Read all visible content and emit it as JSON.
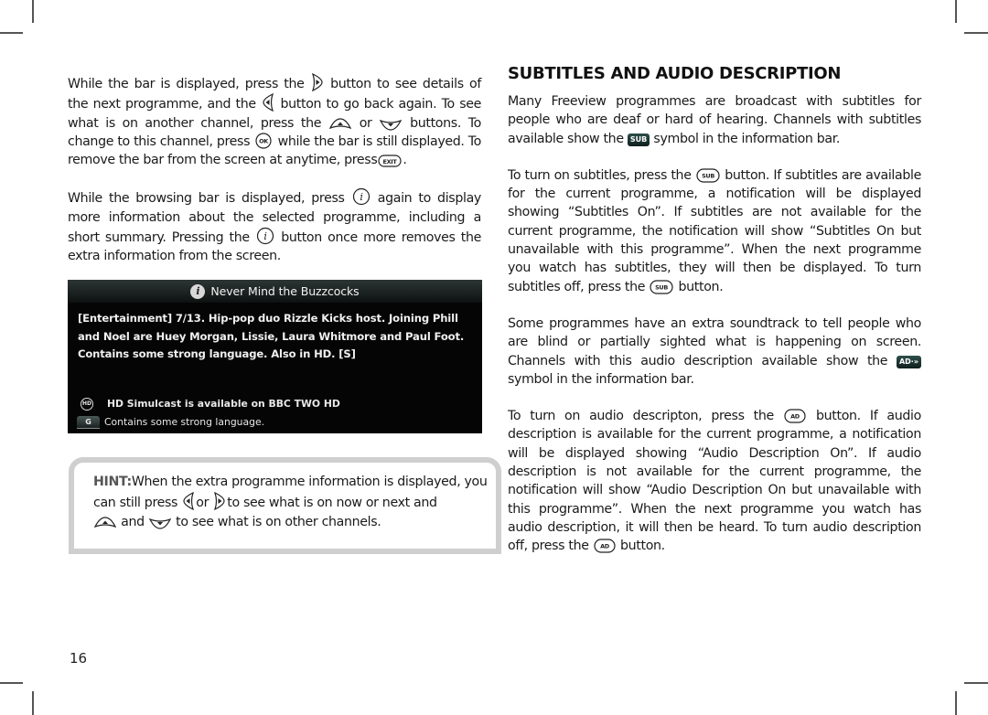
{
  "page": {
    "number": "16"
  },
  "left_column": {
    "para1": {
      "t1": "While the bar is displayed, press the",
      "t2": "button to see details of the next programme, and the",
      "t3": "button to go back again. To see what is on another channel, press the",
      "t4": "or",
      "t5": "buttons. To change to this channel, press",
      "t6": "while the bar is still displayed. To remove the bar from the screen at anytime, press",
      "t7": "."
    },
    "para2": {
      "t1": "While the browsing bar is displayed, press",
      "t2": "again to display more information about the selected programme, including a short summary. Pressing the",
      "t3": "button once more removes the extra information from the screen."
    }
  },
  "tv_panel": {
    "title": "Never Mind the Buzzcocks",
    "description": "[Entertainment] 7/13. Hip-pop duo Rizzle Kicks host. Joining Phill and Noel are Huey Morgan, Lissie, Laura Whitmore and Paul Foot. Contains some strong language.  Also in HD. [S]",
    "hd_icon_label": "HD",
    "hd_text": "HD Simulcast is available on  BBC TWO HD",
    "guidance_badge": "G",
    "guidance_text": "Contains some strong language."
  },
  "hint": {
    "label": "HINT:",
    "t1": "When the extra programme information is displayed, you can still press",
    "t2": "or",
    "t3": "to see what is on now or next and",
    "t4": "and",
    "t5": "to see what is on other channels."
  },
  "right_column": {
    "heading": "SUBTITLES AND AUDIO DESCRIPTION",
    "para1": {
      "t1": "Many Freeview programmes are broadcast with subtitles for people who are deaf or hard of hearing. Channels with subtitles available show the",
      "badge": "SUB",
      "t2": "symbol in the information bar."
    },
    "para2": {
      "t1": "To turn on subtitles, press the",
      "t2": "button. If subtitles are available for the current programme, a notification will be displayed showing “Subtitles On”. If subtitles are not available for the current programme, the notification will show “Subtitles On but unavailable with this programme”. When the next programme you watch has subtitles, they will then be displayed. To turn subtitles off, press the",
      "t3": "button."
    },
    "para3": {
      "t1": "Some programmes have an extra soundtrack to tell people who are blind or partially sighted what is happening on screen. Channels with this audio description available show the",
      "badge": "AD·»",
      "t2": "symbol in the information bar."
    },
    "para4": {
      "t1": "To turn on audio descripton, press the",
      "t2": "button. If audio description is available for the current programme, a notification will be displayed showing “Audio Description On”. If audio description is not available for the current programme, the notification will show “Audio Description On but unavailable with this programme”. When the next programme you watch has audio description, it will then be heard. To turn audio description off, press the",
      "t3": "button."
    }
  },
  "icons": {
    "ok_label": "OK",
    "exit_label": "EXIT",
    "sub_label": "SUB",
    "ad_label": "AD",
    "info_label": "i"
  }
}
